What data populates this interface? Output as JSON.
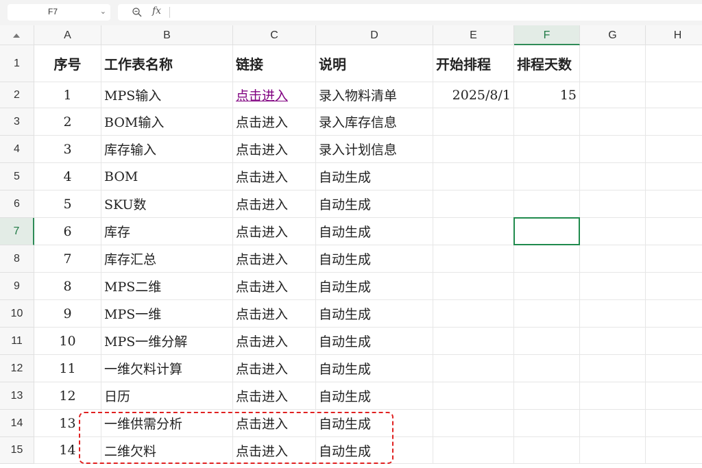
{
  "formula_bar": {
    "name_box": "F7",
    "fx_label": "fx",
    "formula": ""
  },
  "columns": [
    "A",
    "B",
    "C",
    "D",
    "E",
    "F",
    "G",
    "H"
  ],
  "selected_column": "F",
  "selected_row": "7",
  "rows": [
    {
      "num": "1",
      "cells": [
        "序号",
        "工作表名称",
        "链接",
        "说明",
        "开始排程",
        "排程天数",
        "",
        ""
      ]
    },
    {
      "num": "2",
      "cells": [
        "1",
        "MPS输入",
        "点击进入",
        "录入物料清单",
        "2025/8/1",
        "15",
        "",
        ""
      ]
    },
    {
      "num": "3",
      "cells": [
        "2",
        "BOM输入",
        "点击进入",
        "录入库存信息",
        "",
        "",
        "",
        ""
      ]
    },
    {
      "num": "4",
      "cells": [
        "3",
        "库存输入",
        "点击进入",
        "录入计划信息",
        "",
        "",
        "",
        ""
      ]
    },
    {
      "num": "5",
      "cells": [
        "4",
        "BOM",
        "点击进入",
        "自动生成",
        "",
        "",
        "",
        ""
      ]
    },
    {
      "num": "6",
      "cells": [
        "5",
        "SKU数",
        "点击进入",
        "自动生成",
        "",
        "",
        "",
        ""
      ]
    },
    {
      "num": "7",
      "cells": [
        "6",
        "库存",
        "点击进入",
        "自动生成",
        "",
        "",
        "",
        ""
      ]
    },
    {
      "num": "8",
      "cells": [
        "7",
        "库存汇总",
        "点击进入",
        "自动生成",
        "",
        "",
        "",
        ""
      ]
    },
    {
      "num": "9",
      "cells": [
        "8",
        "MPS二维",
        "点击进入",
        "自动生成",
        "",
        "",
        "",
        ""
      ]
    },
    {
      "num": "10",
      "cells": [
        "9",
        "MPS一维",
        "点击进入",
        "自动生成",
        "",
        "",
        "",
        ""
      ]
    },
    {
      "num": "11",
      "cells": [
        "10",
        "MPS一维分解",
        "点击进入",
        "自动生成",
        "",
        "",
        "",
        ""
      ]
    },
    {
      "num": "12",
      "cells": [
        "11",
        "一维欠料计算",
        "点击进入",
        "自动生成",
        "",
        "",
        "",
        ""
      ]
    },
    {
      "num": "13",
      "cells": [
        "12",
        "日历",
        "点击进入",
        "自动生成",
        "",
        "",
        "",
        ""
      ]
    },
    {
      "num": "14",
      "cells": [
        "13",
        "一维供需分析",
        "点击进入",
        "自动生成",
        "",
        "",
        "",
        ""
      ]
    },
    {
      "num": "15",
      "cells": [
        "14",
        "二维欠料",
        "点击进入",
        "自动生成",
        "",
        "",
        "",
        ""
      ]
    }
  ],
  "colors": {
    "selection_green": "#1f8a4c",
    "link_purple": "#800080",
    "highlight_dash_red": "#e02020"
  }
}
